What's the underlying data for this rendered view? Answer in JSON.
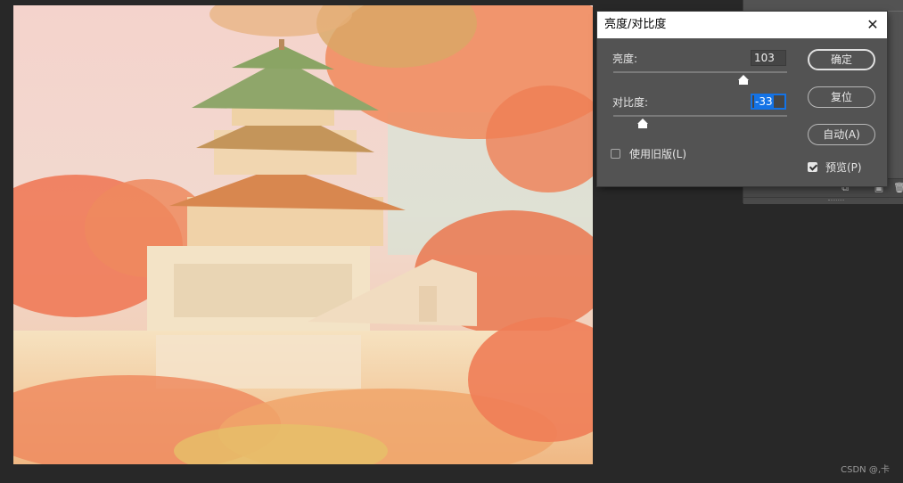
{
  "dialog": {
    "title": "亮度/对比度",
    "brightness": {
      "label": "亮度:",
      "value": "103",
      "level": 0.75
    },
    "contrast": {
      "label": "对比度:",
      "value": "-33",
      "level": 0.17
    },
    "legacy": {
      "label": "使用旧版(L)",
      "checked": false
    },
    "buttons": {
      "ok": "确定",
      "reset": "复位",
      "auto": "自动(A)"
    },
    "preview": {
      "label": "预览(P)",
      "checked": true
    }
  },
  "icons": {
    "close": "close-icon",
    "panel_footer": [
      "link-icon",
      "new-layer-icon",
      "trash-icon"
    ]
  },
  "watermark": "CSDN @,卡",
  "colors": {
    "workspace": "#282828",
    "dialog_bg": "#535353",
    "focus_accent": "#1473e6"
  }
}
